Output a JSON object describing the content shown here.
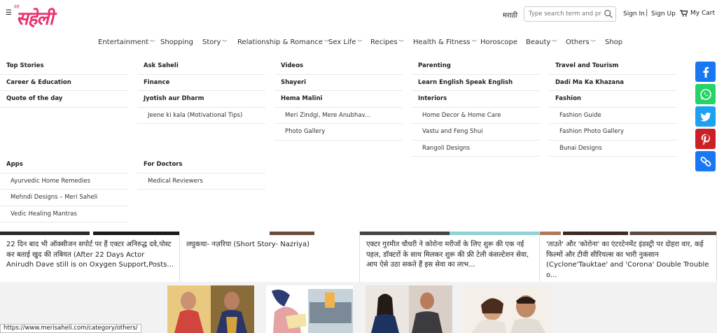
{
  "header": {
    "logo_small": "मेरी",
    "logo_big": "सहेली",
    "language": "मराठी",
    "search_placeholder": "Type search term and press enter",
    "sign_in": "Sign In",
    "separator": "|",
    "sign_up": "Sign Up",
    "cart": "My Cart"
  },
  "nav": {
    "items": [
      {
        "label": "Entertainment",
        "caret": "﹀"
      },
      {
        "label": "Shopping",
        "caret": ""
      },
      {
        "label": "Story",
        "caret": "﹀"
      },
      {
        "label": "Relationship & Romance",
        "caret": "﹀"
      },
      {
        "label": "Sex Life",
        "caret": "﹀"
      },
      {
        "label": "Recipes",
        "caret": "﹀"
      },
      {
        "label": "Health & Fitness",
        "caret": "﹀"
      },
      {
        "label": "Horoscope",
        "caret": ""
      },
      {
        "label": "Beauty",
        "caret": "﹀"
      },
      {
        "label": "Others",
        "caret": "﹀"
      },
      {
        "label": "Shop",
        "caret": ""
      }
    ]
  },
  "mega": {
    "col1": [
      "Top Stories",
      "Career & Education",
      "Quote of the day"
    ],
    "col2": [
      "Ask Saheli",
      "Finance",
      "Jyotish aur Dharm"
    ],
    "col2_sub": [
      "Jeene ki kala (Motivational Tips)"
    ],
    "col3": [
      "Videos",
      "Shayeri",
      "Hema Malini"
    ],
    "col3_sub": [
      "Meri Zindgi, Mere Anubhav...",
      "Photo Gallery"
    ],
    "col4": [
      "Parenting",
      "Learn English Speak English",
      "Interiors"
    ],
    "col4_sub": [
      "Home Decor & Home Care",
      "Vastu and Feng Shui",
      "Rangoli Designs"
    ],
    "col5": [
      "Travel and Tourism",
      "Dadi Ma Ka Khazana",
      "Fashion"
    ],
    "col5_sub": [
      "Fashion Guide",
      "Fashion Photo Gallery",
      "Bunai Designs"
    ],
    "apps": {
      "head": "Apps",
      "items": [
        "Ayurvedic Home Remedies",
        "Mehndi Designs – Meri Saheli",
        "Vedic Healing Mantras"
      ]
    },
    "doctors": {
      "head": "For Doctors",
      "items": [
        "Medical Reviewers"
      ]
    }
  },
  "share": [
    {
      "icon": "facebook-icon",
      "color": "#1877f2"
    },
    {
      "icon": "whatsapp-icon",
      "color": "#25d366"
    },
    {
      "icon": "twitter-icon",
      "color": "#1da1f2"
    },
    {
      "icon": "pinterest-icon",
      "color": "#cb2027"
    },
    {
      "icon": "copy-link-icon",
      "color": "#1877f2"
    }
  ],
  "cards": [
    {
      "text": "22 दिन बाद भी ऑक्सीजन सपोर्ट पर हैं एक्टर अनिरुद्ध दवे,पोस्ट कर बताई खुद की तबियत (After 22 Days Actor Anirudh Dave still is on Oxygen Support,Posts..."
    },
    {
      "text": "लघुकथा- नज़रिया (Short Story- Nazriya)"
    },
    {
      "text": "एक्टर गुरमीत चौधरी ने कोरोना मरीजों के लिए शुरू की एक नई पहल, डॉक्टरों के साथ मिलकर शुरू की फ्री टेली कंसल्टेशन सेवा, आप ऐसे उठा सकते हैं इस सेवा का लाभ..."
    },
    {
      "text": "'ताउते' और 'कोरोना' का एंटरटेनमेंट इंडस्ट्री पर दोहरा वार, कई फिल्मों और टीवी सीरियल्स का भारी नुकसान (Cyclone'Tauktae' and 'Corona' Double Trouble o..."
    }
  ],
  "status_url": "https://www.merisaheli.com/category/others/",
  "colors": {
    "brand": "#e8336e"
  }
}
